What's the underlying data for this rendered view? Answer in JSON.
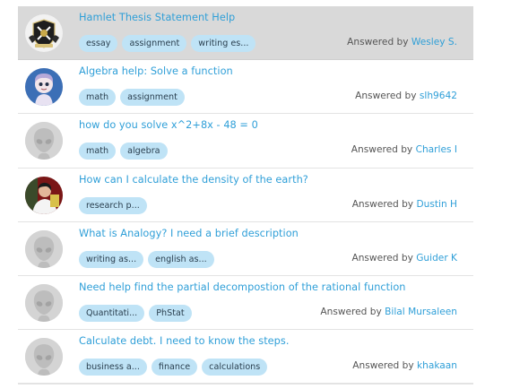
{
  "questions": [
    {
      "title": "Hamlet Thesis Statement Help",
      "tags": [
        "essay",
        "assignment",
        "writing es..."
      ],
      "answered_prefix": "Answered by",
      "answerer": "Wesley S.",
      "avatar": "crest-avatar"
    },
    {
      "title": "Algebra help: Solve a function",
      "tags": [
        "math",
        "assignment"
      ],
      "answered_prefix": "Answered by",
      "answerer": "slh9642",
      "avatar": "character-avatar"
    },
    {
      "title": "how do you solve x^2+8x - 48 = 0",
      "tags": [
        "math",
        "algebra"
      ],
      "answered_prefix": "Answered by",
      "answerer": "Charles I",
      "avatar": "default-alien-avatar"
    },
    {
      "title": "How can I calculate the density of the earth?",
      "tags": [
        "research p..."
      ],
      "answered_prefix": "Answered by",
      "answerer": "Dustin H",
      "avatar": "photo-avatar"
    },
    {
      "title": "What is Analogy? I need a brief description",
      "tags": [
        "writing as...",
        "english as..."
      ],
      "answered_prefix": "Answered by",
      "answerer": "Guider K",
      "avatar": "default-alien-avatar"
    },
    {
      "title": "Need help find the partial decompostion of the rational function",
      "tags": [
        "Quantitati...",
        "PhStat"
      ],
      "answered_prefix": "Answered by",
      "answerer": "Bilal Mursaleen",
      "avatar": "default-alien-avatar"
    },
    {
      "title": "Calculate debt. I need to know the steps.",
      "tags": [
        "business a...",
        "finance",
        "calculations"
      ],
      "answered_prefix": "Answered by",
      "answerer": "khakaan",
      "avatar": "default-alien-avatar"
    }
  ],
  "colors": {
    "link": "#2f9fd8",
    "tag_bg": "#bfe3f6",
    "highlight_row": "#d9d9d9",
    "divider": "#e3e3e3"
  }
}
